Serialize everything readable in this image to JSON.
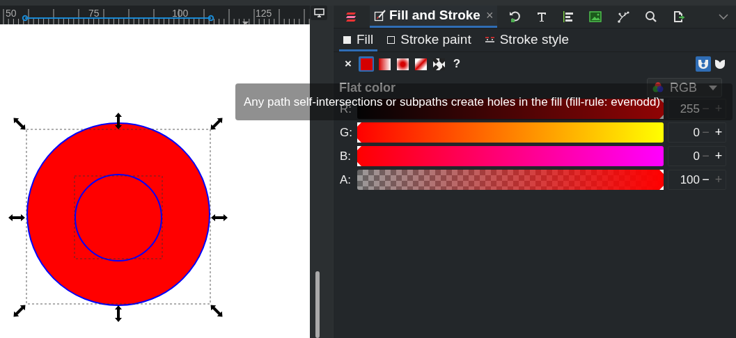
{
  "ruler": {
    "labels": [
      "50",
      "75",
      "100",
      "125"
    ]
  },
  "dock_tabs": [
    {
      "label": "Fill and Stroke",
      "close": "×",
      "selected": true
    }
  ],
  "sub_tabs": [
    {
      "label": "Fill",
      "kind": "fill",
      "selected": true
    },
    {
      "label": "Stroke paint",
      "kind": "stroke",
      "selected": false
    },
    {
      "label": "Stroke style",
      "kind": "style",
      "selected": false
    }
  ],
  "paint_types": [
    {
      "kind": "none",
      "label": "×",
      "selected": false
    },
    {
      "kind": "flat",
      "selected": true
    },
    {
      "kind": "linear",
      "selected": false
    },
    {
      "kind": "radial",
      "selected": false
    },
    {
      "kind": "mesh",
      "selected": false
    },
    {
      "kind": "swatch",
      "selected": false
    },
    {
      "kind": "unset",
      "label": "?",
      "selected": false
    }
  ],
  "fill_rules": [
    {
      "kind": "evenodd",
      "selected": true
    },
    {
      "kind": "nonzero",
      "selected": false
    }
  ],
  "section_title": "Flat color",
  "color_mode": "RGB",
  "channels": [
    {
      "label": "R:",
      "kind": "r",
      "level": 1,
      "value": "255",
      "minus": {
        "label": "−",
        "disabled": true
      },
      "plus": {
        "label": "+",
        "disabled": true
      }
    },
    {
      "label": "G:",
      "kind": "g",
      "level": 0,
      "value": "0",
      "minus": {
        "label": "−",
        "disabled": true
      },
      "plus": {
        "label": "+",
        "disabled": false
      }
    },
    {
      "label": "B:",
      "kind": "b",
      "level": 0,
      "value": "0",
      "minus": {
        "label": "−",
        "disabled": true
      },
      "plus": {
        "label": "+",
        "disabled": false
      }
    },
    {
      "label": "A:",
      "kind": "a",
      "level": 1,
      "value": "100",
      "minus": {
        "label": "−",
        "disabled": false
      },
      "plus": {
        "label": "+",
        "disabled": true
      }
    }
  ],
  "tooltip": "Any path self-intersections or subpaths create holes in the fill (fill-rule: evenodd)"
}
